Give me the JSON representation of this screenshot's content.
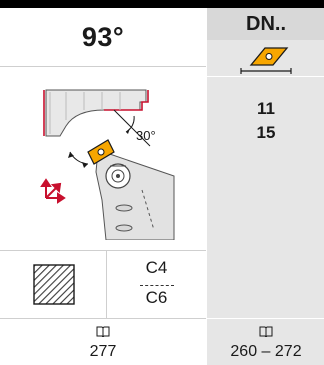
{
  "header": {
    "approach_angle": "93°",
    "insert_series": "DN.."
  },
  "sizes": [
    "11",
    "15"
  ],
  "drawing": {
    "clearance_angle": "30°",
    "insert_color": "#f7a600",
    "accent_color": "#c8102e"
  },
  "grade": {
    "top": "C4",
    "bottom": "C6"
  },
  "page_refs": {
    "left": "277",
    "right": "260 – 272",
    "icon": "book-icon"
  }
}
